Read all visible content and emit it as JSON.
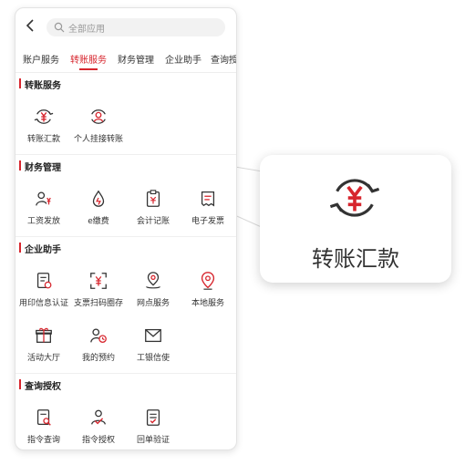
{
  "search": {
    "placeholder": "全部应用"
  },
  "tabs": [
    "账户服务",
    "转账服务",
    "财务管理",
    "企业助手",
    "查询授权"
  ],
  "active_tab": "转账服务",
  "sections": {
    "transfer": {
      "title": "转账服务",
      "items": [
        {
          "label": "转账汇款",
          "icon": "yuan-transfer-icon"
        },
        {
          "label": "个人挂接转账",
          "icon": "person-transfer-icon"
        }
      ]
    },
    "finance": {
      "title": "财务管理",
      "items": [
        {
          "label": "工资发放",
          "icon": "salary-icon"
        },
        {
          "label": "e缴费",
          "icon": "payment-drop-icon"
        },
        {
          "label": "会计记账",
          "icon": "accounting-icon"
        },
        {
          "label": "电子发票",
          "icon": "invoice-icon"
        }
      ]
    },
    "assistant": {
      "title": "企业助手",
      "items": [
        {
          "label": "用印信息认证",
          "icon": "seal-doc-icon"
        },
        {
          "label": "支票扫码圈存",
          "icon": "scan-yuan-icon"
        },
        {
          "label": "网点服务",
          "icon": "branch-pin-icon"
        },
        {
          "label": "本地服务",
          "icon": "location-pin-icon"
        },
        {
          "label": "活动大厅",
          "icon": "gift-icon"
        },
        {
          "label": "我的预约",
          "icon": "appointment-icon"
        },
        {
          "label": "工银信使",
          "icon": "mail-icon"
        }
      ]
    },
    "query": {
      "title": "查询授权",
      "items": [
        {
          "label": "指令查询",
          "icon": "order-query-icon"
        },
        {
          "label": "指令授权",
          "icon": "order-auth-icon"
        },
        {
          "label": "回单验证",
          "icon": "receipt-verify-icon"
        }
      ]
    }
  },
  "callout": {
    "label": "转账汇款",
    "icon": "yuan-transfer-icon"
  },
  "colors": {
    "accent": "#d7262e",
    "text": "#333333",
    "muted": "#999999"
  }
}
